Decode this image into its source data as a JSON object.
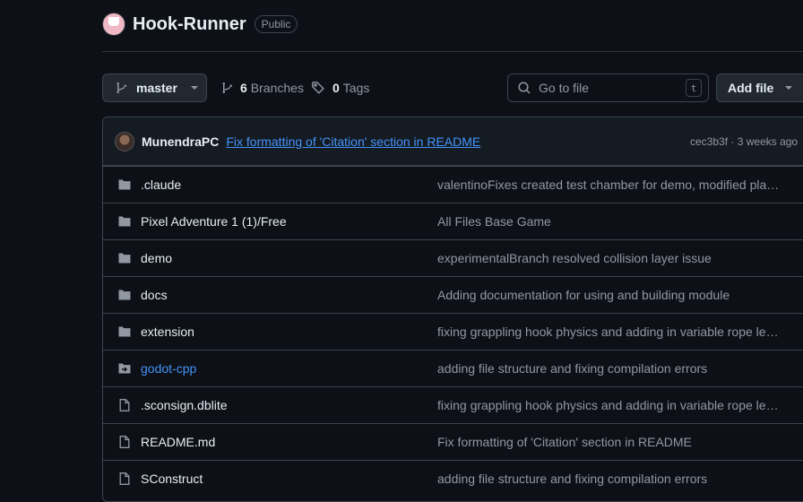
{
  "repo": {
    "name": "Hook-Runner",
    "visibility": "Public"
  },
  "toolbar": {
    "branch": "master",
    "branches_count": "6",
    "branches_label": "Branches",
    "tags_count": "0",
    "tags_label": "Tags",
    "goto_placeholder": "Go to file",
    "goto_shortcut": "t",
    "add_file_label": "Add file"
  },
  "latest_commit": {
    "author": "MunendraPC",
    "message": "Fix formatting of 'Citation' section in README",
    "hash": "cec3b3f",
    "separator": "·",
    "age": "3 weeks ago"
  },
  "files": [
    {
      "name": ".claude",
      "type": "folder",
      "message": "valentinoFixes created test chamber for demo, modified player and level logic"
    },
    {
      "name": "Pixel Adventure 1 (1)/Free",
      "type": "folder",
      "message": "All Files Base Game"
    },
    {
      "name": "demo",
      "type": "folder",
      "message": "experimentalBranch resolved collision layer issue"
    },
    {
      "name": "docs",
      "type": "folder",
      "message": "Adding documentation for using and building module"
    },
    {
      "name": "extension",
      "type": "folder",
      "message": "fixing grappling hook physics and adding in variable rope length"
    },
    {
      "name": "godot-cpp",
      "type": "submodule",
      "message": "adding file structure and fixing compilation errors"
    },
    {
      "name": ".sconsign.dblite",
      "type": "file",
      "message": "fixing grappling hook physics and adding in variable rope length"
    },
    {
      "name": "README.md",
      "type": "file",
      "message": "Fix formatting of 'Citation' section in README"
    },
    {
      "name": "SConstruct",
      "type": "file",
      "message": "adding file structure and fixing compilation errors"
    }
  ],
  "colors": {
    "background": "#0d1117",
    "link": "#4493f8",
    "muted": "#9198a1",
    "border": "#3d444d"
  }
}
